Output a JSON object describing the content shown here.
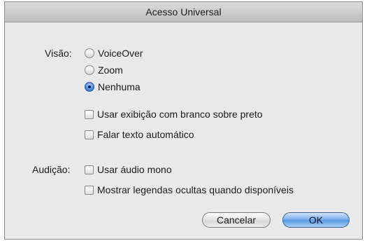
{
  "window": {
    "title": "Acesso Universal"
  },
  "vision": {
    "label": "Visão:",
    "options": [
      {
        "label": "VoiceOver",
        "selected": false
      },
      {
        "label": "Zoom",
        "selected": false
      },
      {
        "label": "Nenhuma",
        "selected": true
      }
    ],
    "checkboxes": [
      {
        "label": "Usar exibição com branco sobre preto",
        "checked": false
      },
      {
        "label": "Falar texto automático",
        "checked": false
      }
    ]
  },
  "hearing": {
    "label": "Audição:",
    "checkboxes": [
      {
        "label": "Usar áudio mono",
        "checked": false
      },
      {
        "label": "Mostrar legendas ocultas quando disponíveis",
        "checked": false
      }
    ]
  },
  "buttons": {
    "cancel": "Cancelar",
    "ok": "OK"
  },
  "colors": {
    "default_button": "#5b98e0",
    "selected_radio": "#3e7bd4"
  }
}
